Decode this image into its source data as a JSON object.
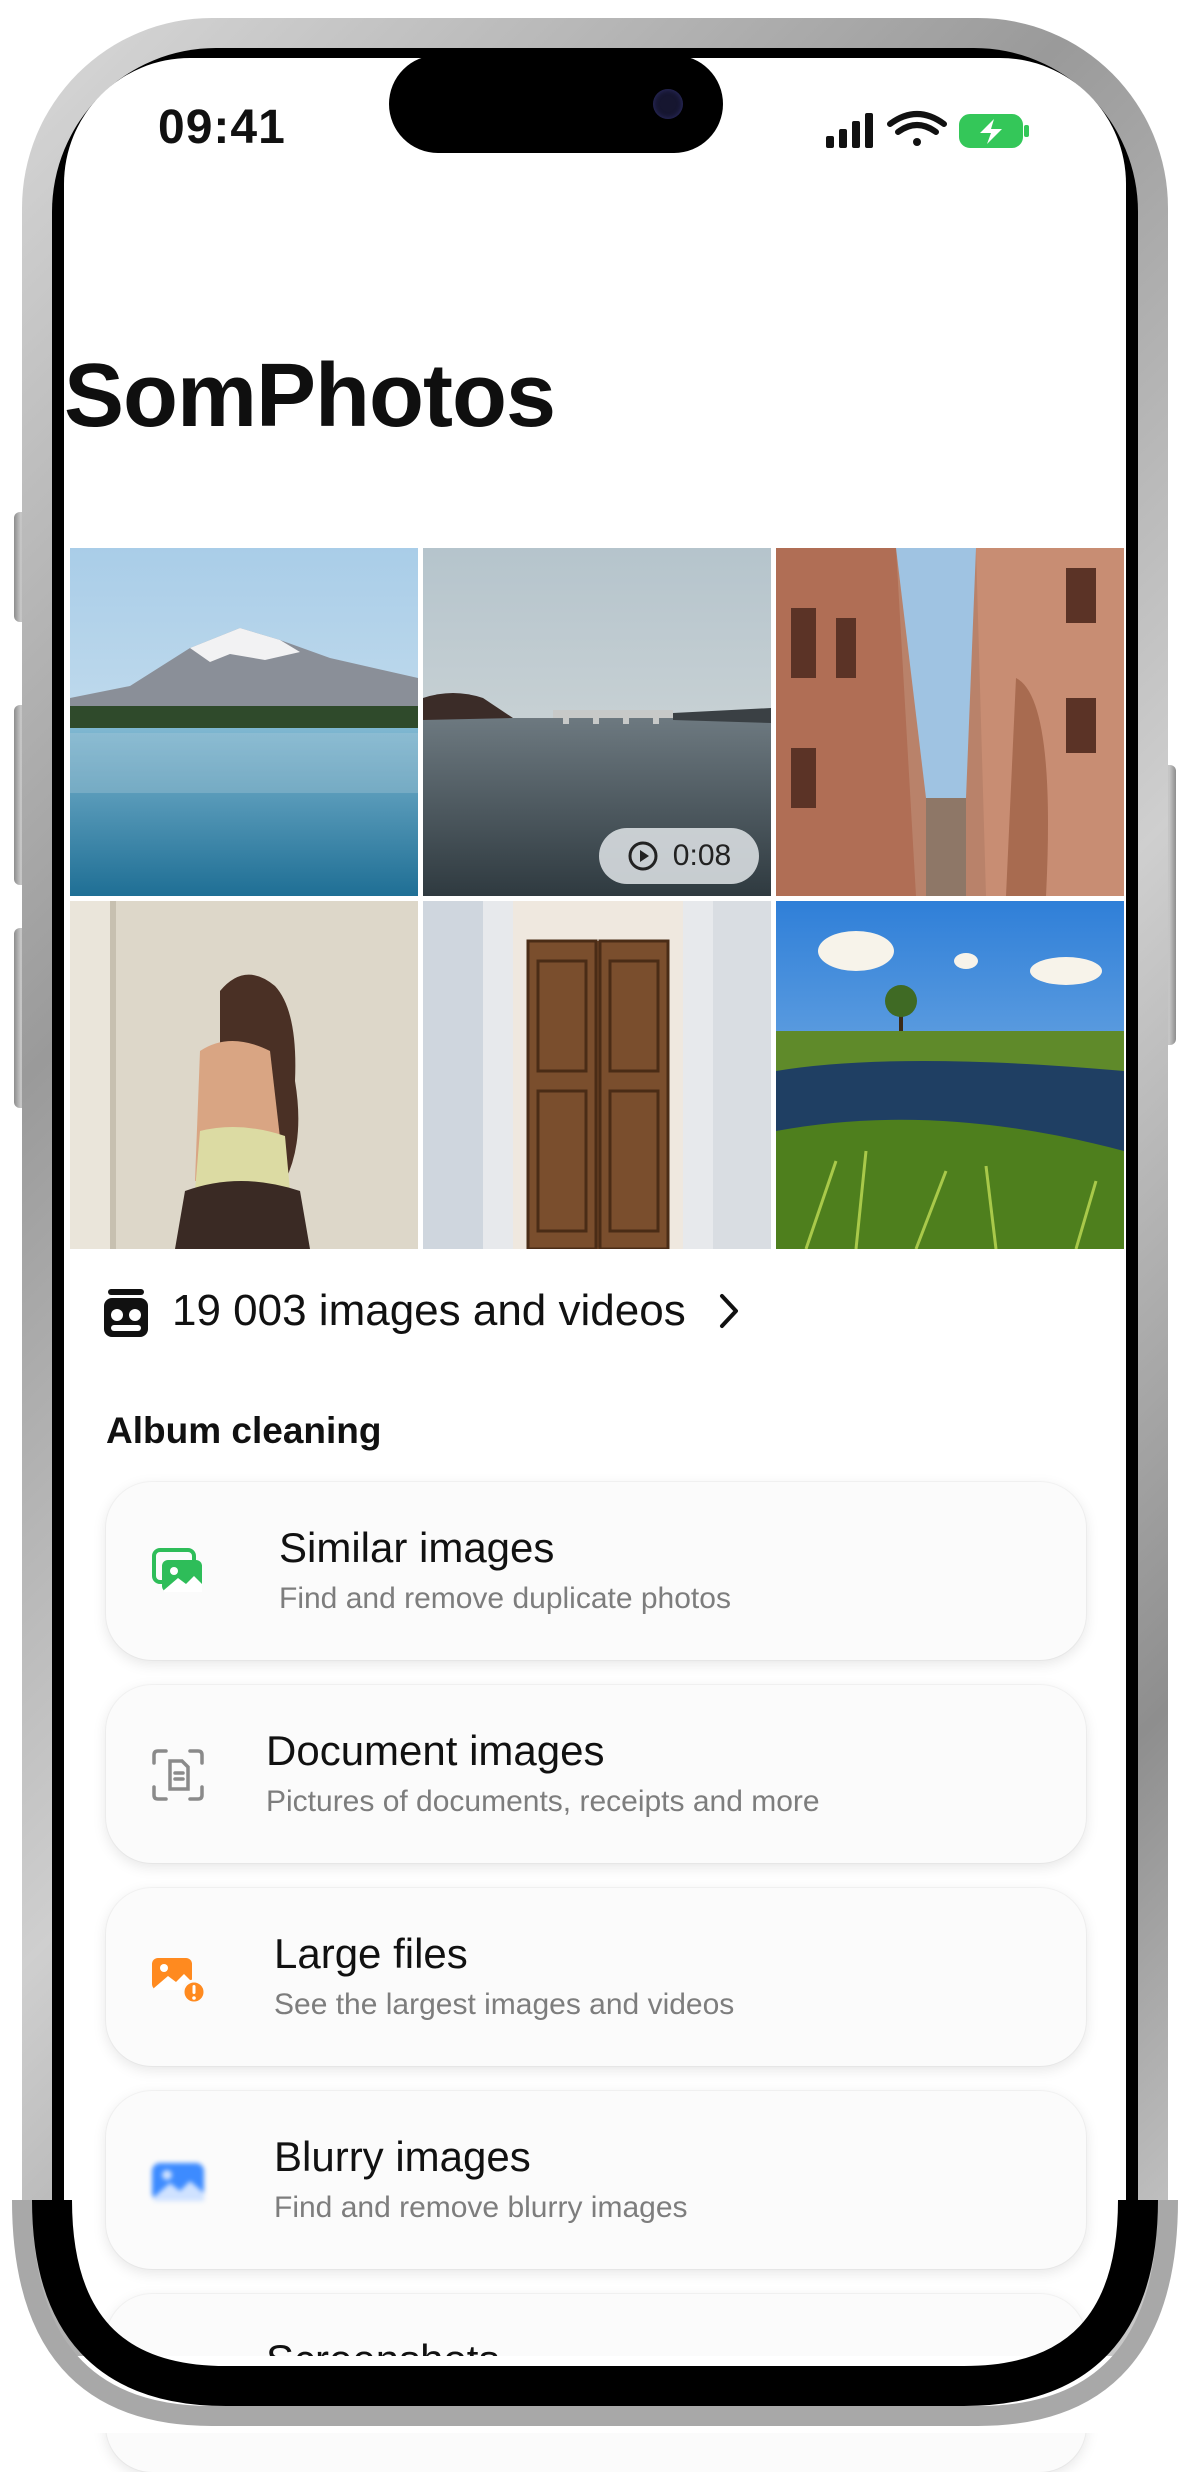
{
  "status_bar": {
    "time": "09:41"
  },
  "header": {
    "title": "SomPhotos"
  },
  "gallery": {
    "video_duration": "0:08",
    "count_label": "19 003 images and videos"
  },
  "album_cleaning": {
    "section_title": "Album cleaning",
    "items": [
      {
        "title": "Similar images",
        "subtitle": "Find and remove duplicate photos",
        "icon": "similar-images-icon",
        "color": "#2ebd59"
      },
      {
        "title": "Document images",
        "subtitle": "Pictures of documents, receipts and more",
        "icon": "document-scan-icon",
        "color": "#8a8a8a"
      },
      {
        "title": "Large files",
        "subtitle": "See the largest images and videos",
        "icon": "large-file-warning-icon",
        "color": "#ff8a1f"
      },
      {
        "title": "Blurry images",
        "subtitle": "Find and remove blurry images",
        "icon": "blurry-image-icon",
        "color": "#3d8bff"
      },
      {
        "title": "Screenshots",
        "subtitle": "",
        "icon": "screenshot-icon",
        "color": "#e5332a"
      }
    ]
  },
  "colors": {
    "accent_green": "#2ebd59",
    "battery_green": "#34c759",
    "text_primary": "#111111",
    "text_secondary": "#7d7d7d"
  }
}
